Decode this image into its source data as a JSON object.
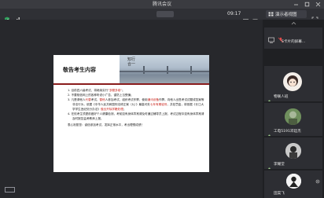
{
  "window": {
    "title": "腾讯会议",
    "controls": [
      "minimize",
      "maximize",
      "close"
    ]
  },
  "toolbar": {
    "timer": "09:17",
    "view_button_label": "演示者视图",
    "icons": [
      "shield-icon",
      "signal-icon",
      "info-icon",
      "hand-icon",
      "grid-icon",
      "expand-icon"
    ]
  },
  "slide": {
    "heading": "敬告考生内容",
    "photo_caption": "知行\n合一",
    "items": [
      {
        "parts": [
          "1. 目前四六级考试，将继续实行",
          {
            "hl": "\"多题多卷\""
          },
          "；"
        ]
      },
      {
        "parts": [
          "2. 不要相信网上的各种听说小广告，谨防上当受骗；"
        ]
      },
      {
        "parts": [
          "3. 凡是请他人",
          {
            "hl": "代替"
          },
          "考试，",
          {
            "hl": "替他"
          },
          "人参加考试，组织考试作弊，使用",
          {
            "hl": "通讯设备"
          },
          "作弊，向他人出售考试试题或答案等非法行为，依据《中华人民共和国刑法修正案（九）》最高可处",
          {
            "hl": "七年有期徒刑"
          },
          "，并处罚金，将依据《长江大学学生违纪处分办法》",
          {
            "hl": "做出开除学籍处理"
          },
          "；"
        ]
      },
      {
        "parts": [
          "4. 在校考生须提前做好个人健康检测，考前如有身体异常请及时通过辅导员上报，考试过程中如有身体异常请及时报告监考教师上报。"
        ]
      }
    ],
    "closing": "衷心祝愿您：诚信参加考试，发挥正常水平，考出理想成绩！"
  },
  "participants": [
    {
      "name": "S卡片的屏幕...",
      "tile": "top"
    },
    {
      "name": "物联人班",
      "tile": "1"
    },
    {
      "name": "工电5191邓廷杰",
      "tile": "2"
    },
    {
      "name": "李耀堂",
      "tile": "3"
    },
    {
      "name": "田昊飞",
      "tile": "4"
    }
  ],
  "colors": {
    "accent_red": "#c8231b",
    "rule_red": "#8a1c1c",
    "bg_dark": "#2b2c30"
  }
}
